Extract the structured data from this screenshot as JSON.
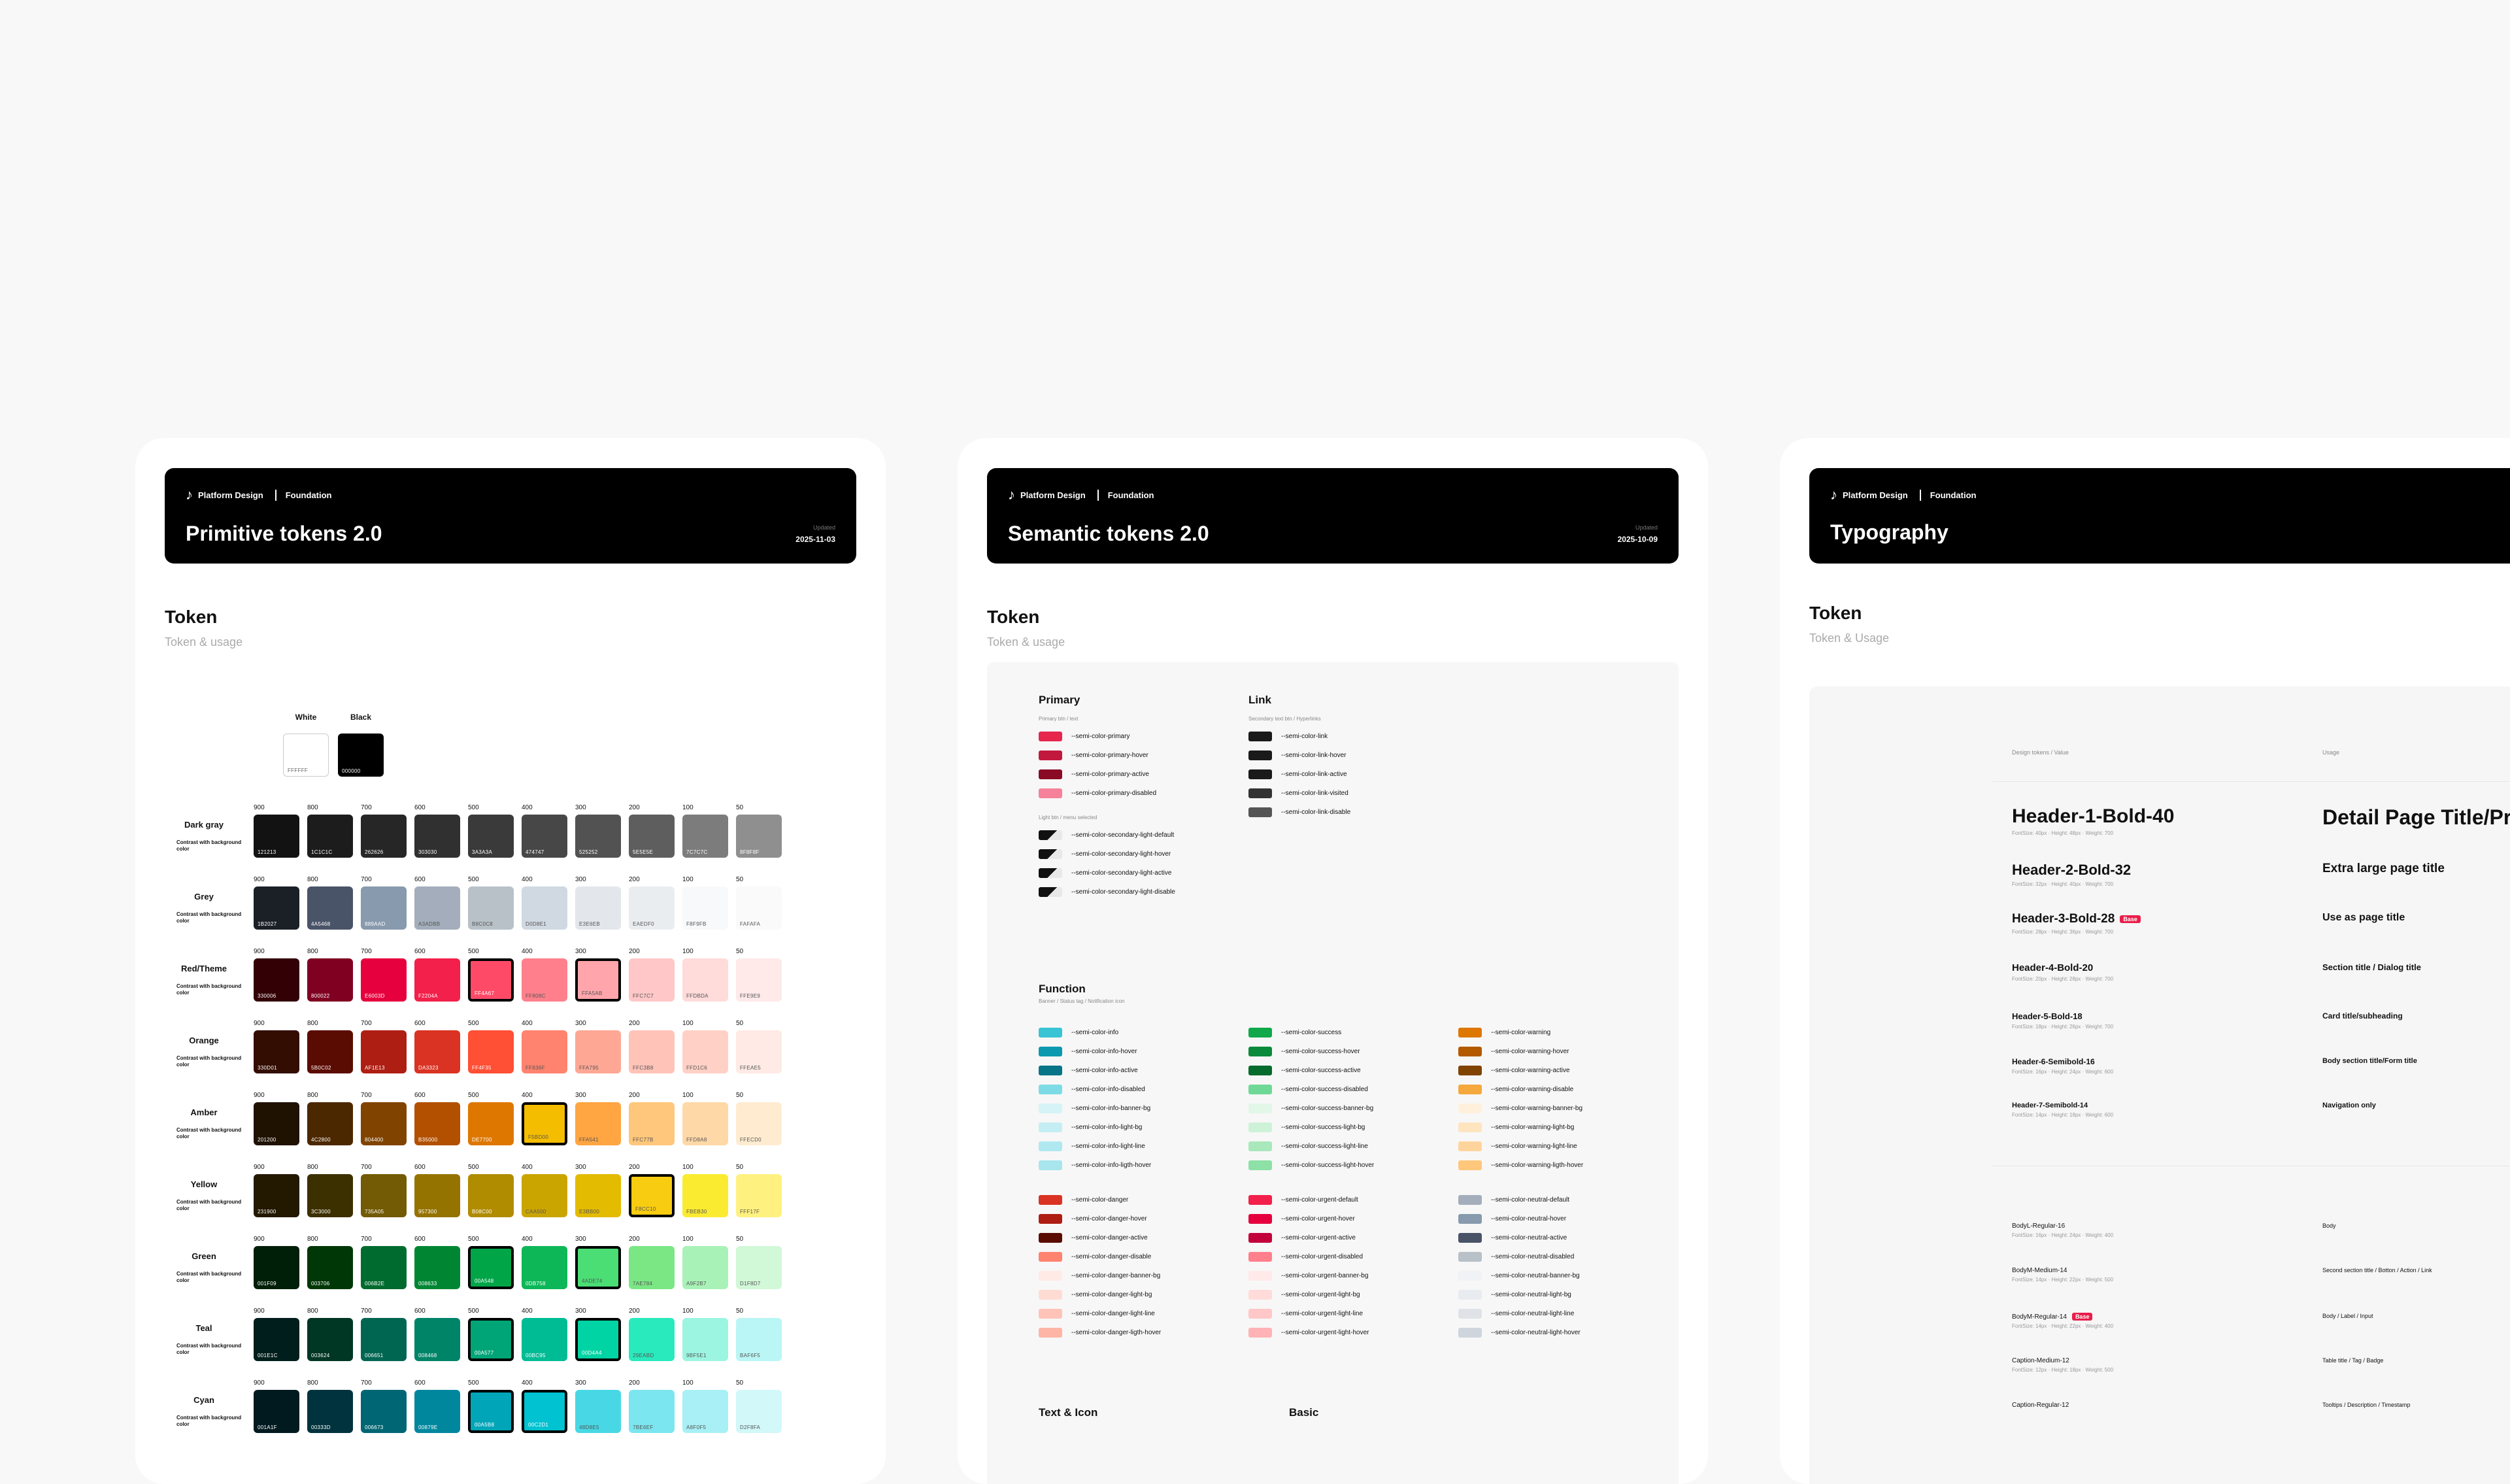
{
  "cards": [
    {
      "brand": "Platform Design",
      "section": "Foundation",
      "title": "Primitive tokens 2.0",
      "updated_label": "Updated",
      "updated_date": "2025-11-03"
    },
    {
      "brand": "Platform Design",
      "section": "Foundation",
      "title": "Semantic tokens 2.0",
      "updated_label": "Updated",
      "updated_date": "2025-10-09"
    },
    {
      "brand": "Platform Design",
      "section": "Foundation",
      "title": "Typography"
    }
  ],
  "primitive": {
    "heading": "Token",
    "sub": "Token & usage",
    "white": {
      "label": "White",
      "hex": "FFFFFF",
      "color": "#ffffff"
    },
    "black": {
      "label": "Black",
      "hex": "000000",
      "color": "#000000"
    },
    "steps": [
      "900",
      "800",
      "700",
      "600",
      "500",
      "400",
      "300",
      "200",
      "100",
      "50"
    ],
    "contrast_note": "Contrast with background color",
    "palettes": [
      {
        "name": "Dark gray",
        "hex": [
          "121213",
          "1C1C1C",
          "262626",
          "303030",
          "3A3A3A",
          "474747",
          "525252",
          "5E5E5E",
          "7C7C7C",
          "8F8F8F"
        ],
        "colors": [
          "#121213",
          "#1c1c1c",
          "#262626",
          "#303030",
          "#3a3a3a",
          "#474747",
          "#525252",
          "#5e5e5e",
          "#7c7c7c",
          "#8f8f8f"
        ],
        "outlined": []
      },
      {
        "name": "Grey",
        "hex": [
          "1B2027",
          "4A5468",
          "889AAD",
          "A3ADBB",
          "B8C0C8",
          "D0D8E1",
          "E3E6EB",
          "EAEDF0",
          "F8F9FB",
          "FAFAFA"
        ],
        "colors": [
          "#1b2027",
          "#4a5468",
          "#889aad",
          "#a3adbb",
          "#b8c0c8",
          "#d0d8e1",
          "#e3e6eb",
          "#eaedf0",
          "#f8f9fb",
          "#fafafa"
        ],
        "outlined": []
      },
      {
        "name": "Red/Theme",
        "hex": [
          "330006",
          "800022",
          "E6003D",
          "F2204A",
          "FF4A67",
          "FF808C",
          "FFA5AB",
          "FFC7C7",
          "FFDBDA",
          "FFE9E9"
        ],
        "colors": [
          "#330006",
          "#800022",
          "#e6003d",
          "#f2204a",
          "#ff4a67",
          "#ff808c",
          "#ffa5ab",
          "#ffc7c7",
          "#ffdbda",
          "#ffe9e9"
        ],
        "outlined": [
          4,
          6
        ]
      },
      {
        "name": "Orange",
        "hex": [
          "330D01",
          "5B0C02",
          "AF1E13",
          "DA3323",
          "FF4F35",
          "FF836F",
          "FFA795",
          "FFC3B8",
          "FFD1C6",
          "FFEAE5"
        ],
        "colors": [
          "#330d01",
          "#5b0c02",
          "#af1e13",
          "#da3323",
          "#ff4f35",
          "#ff836f",
          "#ffa795",
          "#ffc3b8",
          "#ffd1c6",
          "#ffeae5"
        ],
        "outlined": []
      },
      {
        "name": "Amber",
        "hex": [
          "201200",
          "4C2800",
          "804400",
          "B35000",
          "DE7700",
          "F5BD00",
          "FFA541",
          "FFC77B",
          "FFD8A8",
          "FFECD0"
        ],
        "colors": [
          "#201200",
          "#4c2800",
          "#804400",
          "#b35000",
          "#de7700",
          "#f5bd00",
          "#ffa541",
          "#ffc77b",
          "#ffd8a8",
          "#ffecd0"
        ],
        "outlined": [
          5
        ]
      },
      {
        "name": "Yellow",
        "hex": [
          "231900",
          "3C3000",
          "735A05",
          "957300",
          "B08C00",
          "CAA500",
          "E3BB00",
          "F8CC10",
          "FBEB30",
          "FFF17F"
        ],
        "colors": [
          "#231900",
          "#3c3000",
          "#735a05",
          "#957300",
          "#b08c00",
          "#caa500",
          "#e3bb00",
          "#f8cc10",
          "#fbeb30",
          "#fff17f"
        ],
        "outlined": [
          7
        ]
      },
      {
        "name": "Green",
        "hex": [
          "001F09",
          "003706",
          "006B2E",
          "008633",
          "00A548",
          "0DB758",
          "4ADE74",
          "7AE784",
          "A9F2B7",
          "D1F8D7"
        ],
        "colors": [
          "#001f09",
          "#003706",
          "#006b2e",
          "#008633",
          "#00a548",
          "#0db758",
          "#4ade74",
          "#7ae784",
          "#a9f2b7",
          "#d1f8d7"
        ],
        "outlined": [
          4,
          6
        ]
      },
      {
        "name": "Teal",
        "hex": [
          "001E1C",
          "003624",
          "006651",
          "008468",
          "00A577",
          "00BC95",
          "00D4A4",
          "29EABD",
          "9BF5E1",
          "BAF6F5"
        ],
        "colors": [
          "#001e1c",
          "#003624",
          "#006651",
          "#008468",
          "#00a577",
          "#00bc95",
          "#00d4a4",
          "#29eabd",
          "#9bf5e1",
          "#baf6f5"
        ],
        "outlined": [
          4,
          6
        ]
      },
      {
        "name": "Cyan",
        "hex": [
          "001A1F",
          "00333D",
          "006673",
          "00879E",
          "00A5B8",
          "00C2D1",
          "48D8E5",
          "7BE6EF",
          "A8F0F5",
          "D2F8FA"
        ],
        "colors": [
          "#001a1f",
          "#00333d",
          "#006673",
          "#00879e",
          "#00a5b8",
          "#00c2d1",
          "#48d8e5",
          "#7be6ef",
          "#a8f0f5",
          "#d2f8fa"
        ],
        "outlined": [
          4,
          5
        ]
      }
    ]
  },
  "semantic": {
    "heading": "Token",
    "sub": "Token & usage",
    "primary": {
      "title": "Primary",
      "sub1": "Primary btn / text",
      "sub2": "Light btn / menu selected",
      "tokens": [
        {
          "name": "--semi-color-primary",
          "color": "#e6264d"
        },
        {
          "name": "--semi-color-primary-hover",
          "color": "#c2183d"
        },
        {
          "name": "--semi-color-primary-active",
          "color": "#8a0a26"
        },
        {
          "name": "--semi-color-primary-disabled",
          "color": "#f5829a"
        }
      ],
      "light": [
        {
          "name": "--semi-color-secondary-light-default",
          "color": "#111111"
        },
        {
          "name": "--semi-color-secondary-light-hover",
          "color": "#111111"
        },
        {
          "name": "--semi-color-secondary-light-active",
          "color": "#111111"
        },
        {
          "name": "--semi-color-secondary-light-disable",
          "color": "#111111"
        }
      ]
    },
    "link": {
      "title": "Link",
      "sub": "Secondary text btn / Hyperlinks",
      "tokens": [
        {
          "name": "--semi-color-link",
          "color": "#1a1a1a"
        },
        {
          "name": "--semi-color-link-hover",
          "color": "#1a1a1a"
        },
        {
          "name": "--semi-color-link-active",
          "color": "#1a1a1a"
        },
        {
          "name": "--semi-color-link-visited",
          "color": "#333333"
        },
        {
          "name": "--semi-color-link-disable",
          "color": "#555555"
        }
      ]
    },
    "function": {
      "title": "Function",
      "sub": "Banner / Status tag / Notification icon",
      "info": [
        {
          "name": "--semi-color-info",
          "color": "#38c4d4"
        },
        {
          "name": "--semi-color-info-hover",
          "color": "#0a99ae"
        },
        {
          "name": "--semi-color-info-active",
          "color": "#087487"
        },
        {
          "name": "--semi-color-info-disabled",
          "color": "#7ddbe6"
        },
        {
          "name": "--semi-color-info-banner-bg",
          "color": "#d6f3f7"
        },
        {
          "name": "--semi-color-info-light-bg",
          "color": "#c4eef3"
        },
        {
          "name": "--semi-color-info-light-line",
          "color": "#b0e8ef"
        },
        {
          "name": "--semi-color-info-ligth-hover",
          "color": "#a8e5ed"
        }
      ],
      "success": [
        {
          "name": "--semi-color-success",
          "color": "#10a84a"
        },
        {
          "name": "--semi-color-success-hover",
          "color": "#0b8a3b"
        },
        {
          "name": "--semi-color-success-active",
          "color": "#066b2c"
        },
        {
          "name": "--semi-color-success-disabled",
          "color": "#6fd896"
        },
        {
          "name": "--semi-color-success-banner-bg",
          "color": "#e2f7e8"
        },
        {
          "name": "--semi-color-success-light-bg",
          "color": "#cdf2d7"
        },
        {
          "name": "--semi-color-success-light-line",
          "color": "#a8e8bb"
        },
        {
          "name": "--semi-color-success-light-hover",
          "color": "#8de0a6"
        }
      ],
      "warning": [
        {
          "name": "--semi-color-warning",
          "color": "#de7700"
        },
        {
          "name": "--semi-color-warning-hover",
          "color": "#b35a00"
        },
        {
          "name": "--semi-color-warning-active",
          "color": "#804400"
        },
        {
          "name": "--semi-color-warning-disable",
          "color": "#f5a83c"
        },
        {
          "name": "--semi-color-warning-banner-bg",
          "color": "#fff0dc"
        },
        {
          "name": "--semi-color-warning-light-bg",
          "color": "#ffe4c0"
        },
        {
          "name": "--semi-color-warning-light-line",
          "color": "#ffd49c"
        },
        {
          "name": "--semi-color-warning-ligth-hover",
          "color": "#ffc77b"
        }
      ],
      "danger": [
        {
          "name": "--semi-color-danger",
          "color": "#da3323"
        },
        {
          "name": "--semi-color-danger-hover",
          "color": "#af1e13"
        },
        {
          "name": "--semi-color-danger-active",
          "color": "#5b0c02"
        },
        {
          "name": "--semi-color-danger-disable",
          "color": "#ff836f"
        },
        {
          "name": "--semi-color-danger-banner-bg",
          "color": "#ffeae5"
        },
        {
          "name": "--semi-color-danger-light-bg",
          "color": "#ffdcd3"
        },
        {
          "name": "--semi-color-danger-light-line",
          "color": "#ffc3b8"
        },
        {
          "name": "--semi-color-danger-ligth-hover",
          "color": "#ffb5a6"
        }
      ],
      "urgent": [
        {
          "name": "--semi-color-urgent-default",
          "color": "#f2204a"
        },
        {
          "name": "--semi-color-urgent-hover",
          "color": "#e6003d"
        },
        {
          "name": "--semi-color-urgent-active",
          "color": "#c2003a"
        },
        {
          "name": "--semi-color-urgent-disabled",
          "color": "#ff808c"
        },
        {
          "name": "--semi-color-urgent-banner-bg",
          "color": "#ffe9e9"
        },
        {
          "name": "--semi-color-urgent-light-bg",
          "color": "#ffdbda"
        },
        {
          "name": "--semi-color-urgent-light-line",
          "color": "#ffc7c7"
        },
        {
          "name": "--semi-color-urgent-light-hover",
          "color": "#ffb3b6"
        }
      ],
      "neutral": [
        {
          "name": "--semi-color-neutral-default",
          "color": "#a3adbb"
        },
        {
          "name": "--semi-color-neutral-hover",
          "color": "#889aad"
        },
        {
          "name": "--semi-color-neutral-active",
          "color": "#4a5468"
        },
        {
          "name": "--semi-color-neutral-disabled",
          "color": "#b8c0c8"
        },
        {
          "name": "--semi-color-neutral-banner-bg",
          "color": "#f0f2f5"
        },
        {
          "name": "--semi-color-neutral-light-bg",
          "color": "#e8ebef"
        },
        {
          "name": "--semi-color-neutral-light-line",
          "color": "#dfe3e8"
        },
        {
          "name": "--semi-color-neutral-light-hover",
          "color": "#cfd5dc"
        }
      ]
    },
    "text_icon": {
      "title": "Text & Icon"
    },
    "basic": {
      "title": "Basic"
    }
  },
  "typography": {
    "heading": "Token",
    "sub": "Token & Usage",
    "col_tokens": "Design tokens / Value",
    "col_usage": "Usage",
    "rows": [
      {
        "name": "Header-1-Bold-40",
        "meta": "FontSize: 40px  ·  Height: 48px  ·  Weight: 700",
        "usage": "Detail Page Title/Product Title",
        "badge": ""
      },
      {
        "name": "Header-2-Bold-32",
        "meta": "FontSize: 32px  ·  Height: 40px  ·  Weight: 700",
        "usage": "Extra large page title",
        "badge": ""
      },
      {
        "name": "Header-3-Bold-28",
        "meta": "FontSize: 28px  ·  Height: 36px  ·  Weight: 700",
        "usage": "Use as page title",
        "badge": "Base"
      },
      {
        "name": "Header-4-Bold-20",
        "meta": "FontSize: 20px  ·  Height: 28px  ·  Weight: 700",
        "usage": "Section title / Dialog title",
        "badge": ""
      },
      {
        "name": "Header-5-Bold-18",
        "meta": "FontSize: 18px  ·  Height: 26px  ·  Weight: 700",
        "usage": "Card title/subheading",
        "badge": ""
      },
      {
        "name": "Header-6-Semibold-16",
        "meta": "FontSize: 16px  ·  Height: 24px  ·  Weight: 600",
        "usage": "Body section title/Form title",
        "badge": ""
      },
      {
        "name": "Header-7-Semibold-14",
        "meta": "FontSize: 14px  ·  Height: 18px  ·  Weight: 600",
        "usage": "Navigation only",
        "badge": ""
      }
    ],
    "body_rows": [
      {
        "name": "BodyL-Regular-16",
        "meta": "FontSize: 16px  ·  Height: 24px  ·  Weight: 400",
        "usage": "Body",
        "badge": ""
      },
      {
        "name": "BodyM-Medium-14",
        "meta": "FontSize: 14px  ·  Height: 22px  ·  Weight: 500",
        "usage": "Second section title / Botton / Action / Link",
        "badge": ""
      },
      {
        "name": "BodyM-Regular-14",
        "meta": "FontSize: 14px  ·  Height: 22px  ·  Weight: 400",
        "usage": "Body / Label / Input",
        "badge": "Base"
      },
      {
        "name": "Caption-Medium-12",
        "meta": "FontSize: 12px  ·  Height: 18px  ·  Weight: 500",
        "usage": "Table title / Tag / Badge",
        "badge": ""
      },
      {
        "name": "Caption-Regular-12",
        "meta": "",
        "usage": "Tooltips / Description / Timestamp",
        "badge": ""
      }
    ]
  }
}
